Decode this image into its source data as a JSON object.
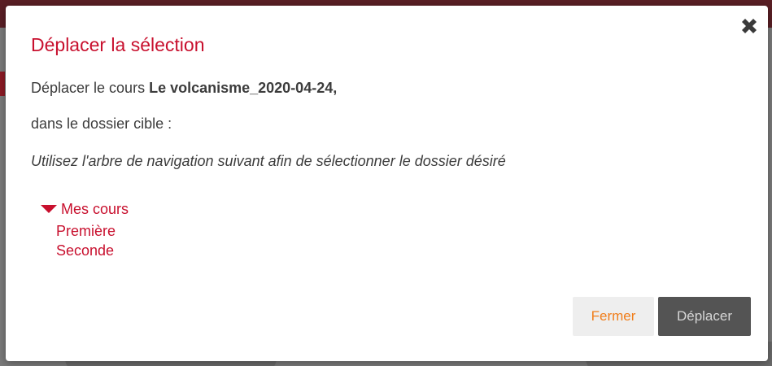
{
  "dialog": {
    "title": "Déplacer la sélection",
    "line1_prefix": "Déplacer le cours ",
    "course_name": "Le volcanisme_2020-04-24,",
    "line2": "dans le dossier cible :",
    "instruction": "Utilisez l'arbre de navigation suivant afin de sélectionner le dossier désiré",
    "close_icon": "close-icon"
  },
  "tree": {
    "root_label": "Mes cours",
    "root_icon": "caret-down-icon",
    "children": [
      "Première",
      "Seconde"
    ]
  },
  "buttons": {
    "close_label": "Fermer",
    "move_label": "Déplacer"
  },
  "colors": {
    "accent": "#c8102e",
    "secondary_button_text": "#f07d1a",
    "primary_button_bg": "#545454"
  }
}
